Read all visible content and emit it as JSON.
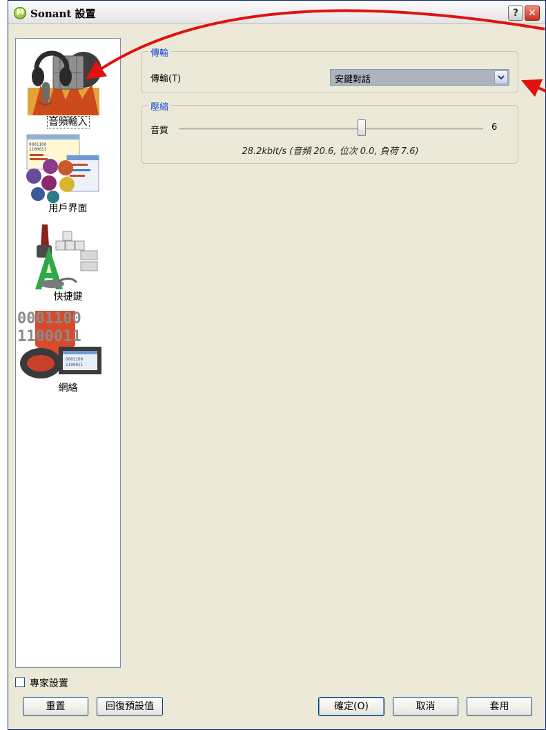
{
  "window": {
    "title": "Sonant 設置",
    "help_label": "?",
    "close_label": "✕"
  },
  "background": {
    "fragments": []
  },
  "sidebar": {
    "items": [
      {
        "id": "audio-input",
        "label": "音頻輸入",
        "icon": "headset-microphone-icon",
        "selected": true
      },
      {
        "id": "user-interface",
        "label": "用戶界面",
        "icon": "user-interface-icon",
        "selected": false
      },
      {
        "id": "shortcuts",
        "label": "快捷鍵",
        "icon": "keyboard-shortcut-icon",
        "selected": false
      },
      {
        "id": "network",
        "label": "網絡",
        "icon": "network-binary-icon",
        "selected": false
      }
    ]
  },
  "transmission": {
    "legend": "傳輸",
    "label": "傳輸(T)",
    "selected": "安鍵對話"
  },
  "compression": {
    "legend": "壓縮",
    "quality_label": "音質",
    "quality_value": "6",
    "quality_min": 0,
    "quality_max": 10,
    "bitrate_text": "28.2kbit/s (音頻 20.6, 位次 0.0, 負荷 7.6)"
  },
  "expert": {
    "label": "專家設置",
    "checked": false
  },
  "buttons": {
    "reset": "重置",
    "restore_defaults": "回復預設值",
    "ok": "確定(O)",
    "cancel": "取消",
    "apply": "套用"
  },
  "colors": {
    "legend_blue": "#1a4ccf",
    "annotation_red": "#e0120f",
    "dialog_bg": "#ece9d8"
  }
}
